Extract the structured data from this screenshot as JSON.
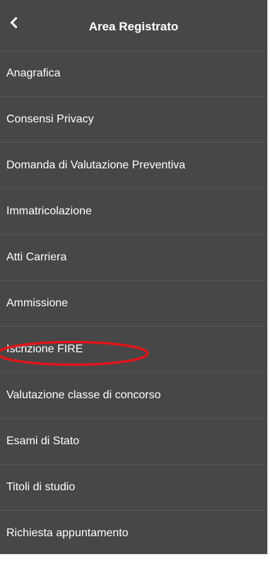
{
  "header": {
    "back_icon": "chevron-left-icon",
    "title": "Area Registrato"
  },
  "menu": {
    "items": [
      {
        "label": "Anagrafica"
      },
      {
        "label": "Consensi Privacy"
      },
      {
        "label": "Domanda di Valutazione Preventiva"
      },
      {
        "label": "Immatricolazione"
      },
      {
        "label": "Atti Carriera"
      },
      {
        "label": "Ammissione"
      },
      {
        "label": "Iscrizione FIRE"
      },
      {
        "label": "Valutazione classe di concorso"
      },
      {
        "label": "Esami di Stato"
      },
      {
        "label": "Titoli di studio"
      },
      {
        "label": "Richiesta appuntamento"
      }
    ]
  },
  "annotation": {
    "highlighted_item": "Iscrizione FIRE",
    "ring_color": "#e0151b"
  },
  "colors": {
    "panel_background": "#474747",
    "divider": "#575757",
    "text": "#ffffff"
  }
}
